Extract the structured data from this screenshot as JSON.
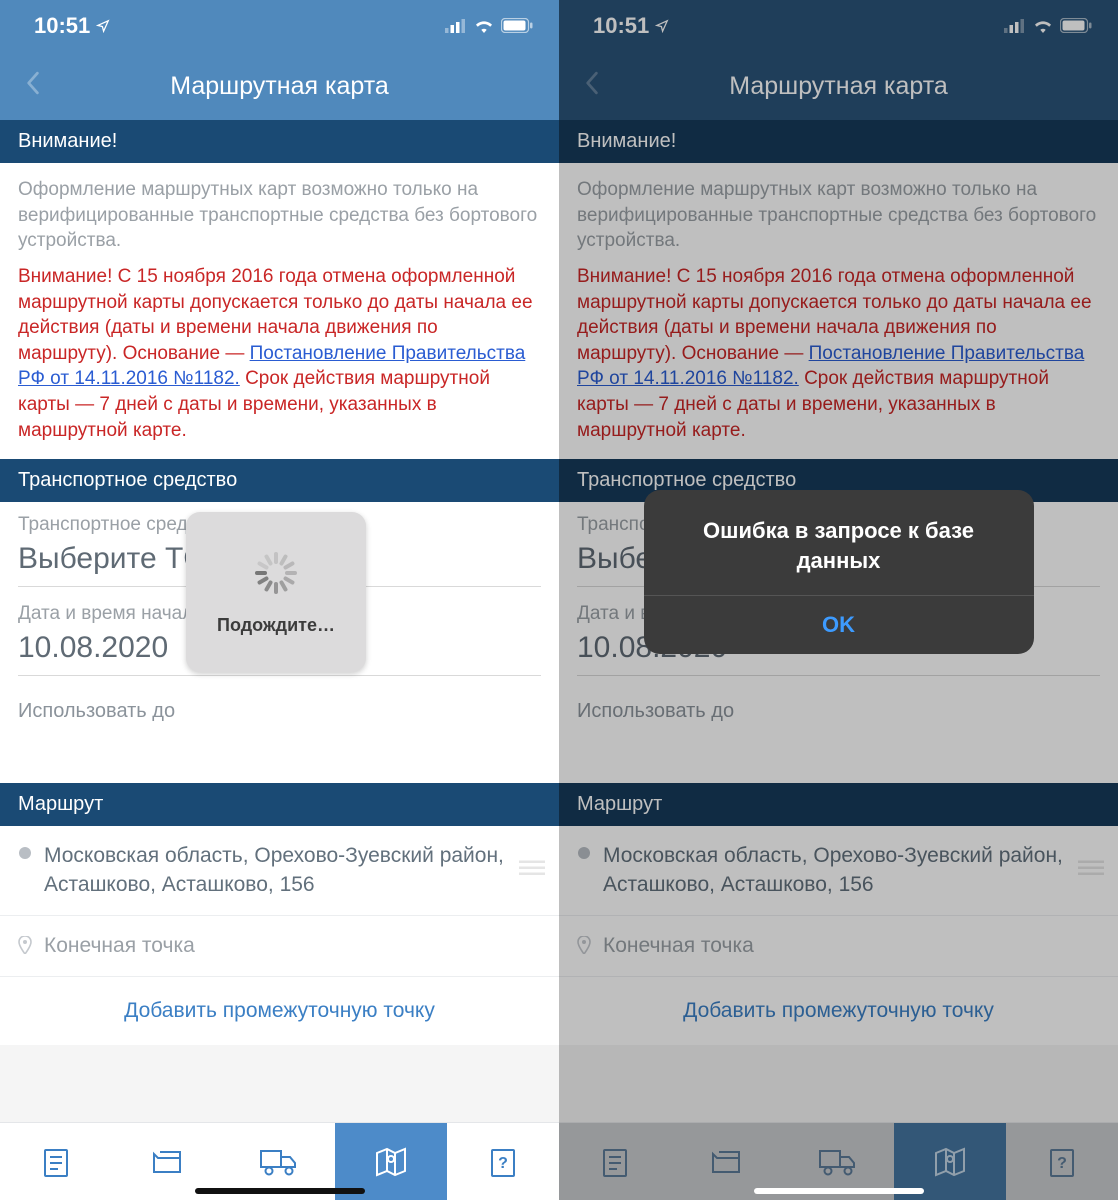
{
  "status": {
    "time": "10:51"
  },
  "header": {
    "title": "Маршрутная карта"
  },
  "sections": {
    "attention": "Внимание!",
    "info_gray": "Оформление маршрутных карт возможно только на верифицированные транспортные средства без бортового устройства.",
    "red_prefix": "Внимание! С 15 ноября 2016 года отмена оформленной маршрутной карты допускается только до даты начала ее действия (даты и времени начала движения по маршруту). Основание — ",
    "red_link": "Постановление Правительства РФ от 14.11.2016 №1182.",
    "red_suffix": " Срок действия маршрутной карты — 7 дней с даты и времени, указанных в маршрутной карте.",
    "vehicle_section": "Транспортное средство",
    "vehicle_label": "Транспортное средство",
    "vehicle_value": "Выберите ТС",
    "start_label": "Дата и время начала",
    "start_value": "10.08.2020",
    "use_until": "Использовать до",
    "route_section": "Маршрут",
    "route_start": "Московская область, Орехово-Зуевский район, Асташково, Асташково, 156",
    "route_end_placeholder": "Конечная точка",
    "add_waypoint": "Добавить промежуточную точку"
  },
  "loading": {
    "text": "Подождите…"
  },
  "alert": {
    "title": "Ошибка в запросе к базе данных",
    "ok": "OK"
  },
  "tabs": [
    "doc",
    "wallet",
    "truck",
    "map",
    "help"
  ],
  "colors": {
    "header_left": "#5089bc",
    "header_right": "#2a5379",
    "section_hdr": "#1a4a74"
  }
}
